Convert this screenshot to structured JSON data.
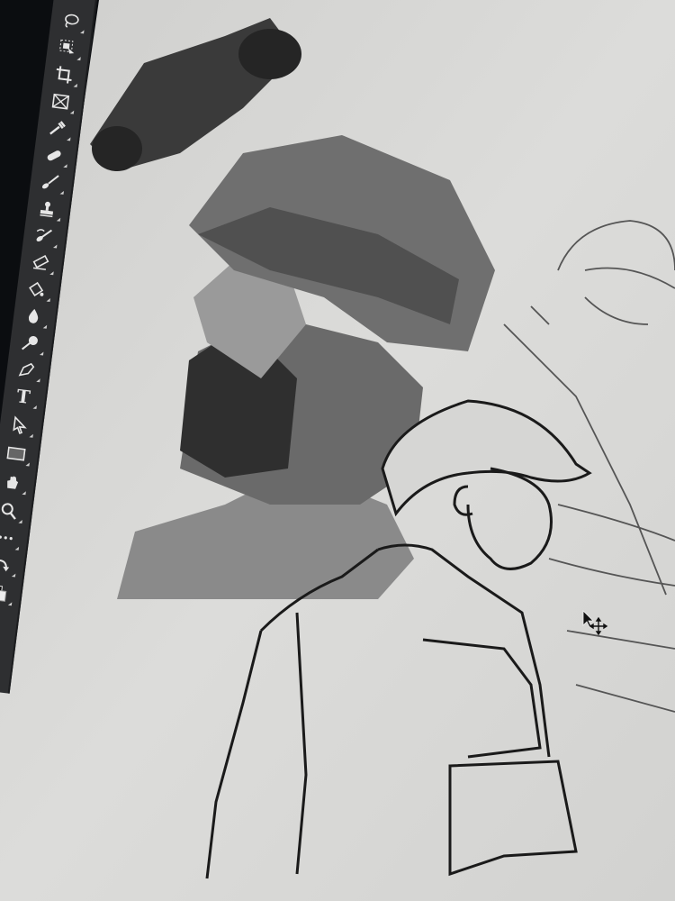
{
  "app": "Photoshop",
  "toolbar": {
    "tools": [
      {
        "name": "lasso-tool",
        "icon": "lasso-icon"
      },
      {
        "name": "object-selection-tool",
        "icon": "object-select-icon"
      },
      {
        "name": "crop-tool",
        "icon": "crop-icon"
      },
      {
        "name": "frame-tool",
        "icon": "frame-icon"
      },
      {
        "name": "eyedropper-tool",
        "icon": "eyedropper-icon"
      },
      {
        "name": "healing-brush-tool",
        "icon": "bandage-icon"
      },
      {
        "name": "brush-tool",
        "icon": "brush-icon"
      },
      {
        "name": "clone-stamp-tool",
        "icon": "stamp-icon"
      },
      {
        "name": "history-brush-tool",
        "icon": "history-brush-icon"
      },
      {
        "name": "eraser-tool",
        "icon": "eraser-icon"
      },
      {
        "name": "paint-bucket-tool",
        "icon": "bucket-icon"
      },
      {
        "name": "blur-tool",
        "icon": "drop-icon"
      },
      {
        "name": "dodge-tool",
        "icon": "dodge-icon"
      },
      {
        "name": "pen-tool",
        "icon": "pen-icon"
      },
      {
        "name": "type-tool",
        "icon": "type-icon",
        "glyph": "T"
      },
      {
        "name": "path-selection-tool",
        "icon": "arrow-icon"
      },
      {
        "name": "rectangle-tool",
        "icon": "rectangle-icon"
      },
      {
        "name": "hand-tool",
        "icon": "hand-icon"
      },
      {
        "name": "zoom-tool",
        "icon": "magnifier-icon"
      },
      {
        "name": "more-tools",
        "icon": "ellipsis-icon"
      },
      {
        "name": "swap-colors",
        "icon": "swap-icon"
      }
    ]
  },
  "colors": {
    "toolbar": "#2e2f31",
    "canvas": "#d8d8d6",
    "ink": "#1a1a1a"
  }
}
